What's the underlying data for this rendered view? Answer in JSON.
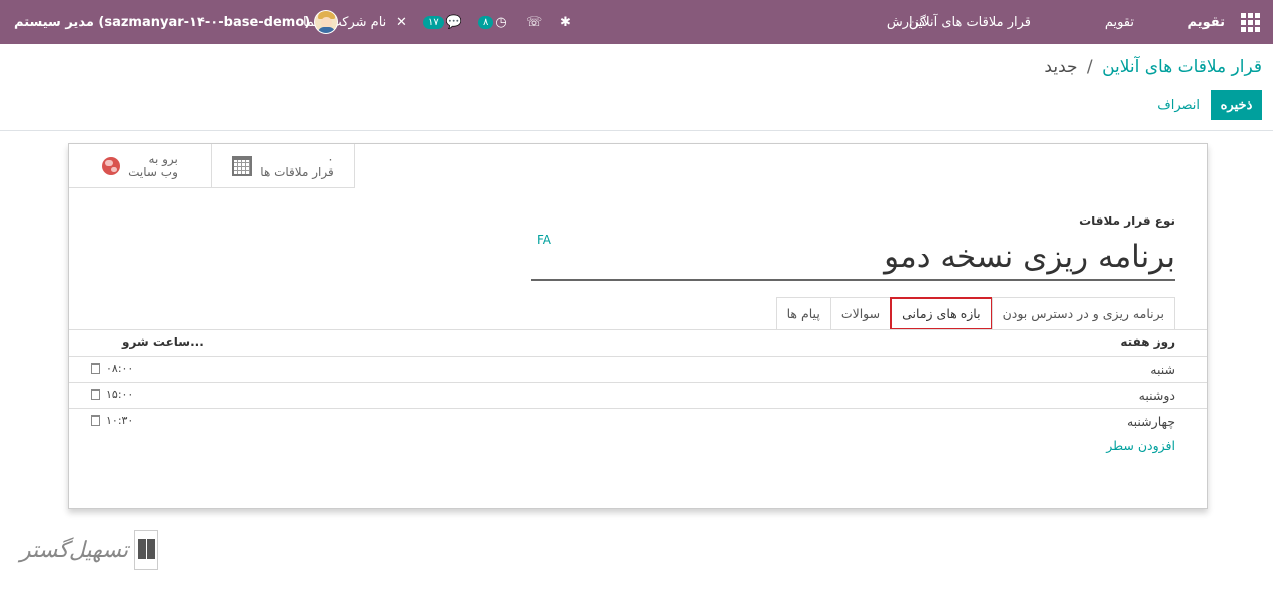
{
  "navbar": {
    "app_name": "تقویم",
    "menus": [
      "تقویم",
      "قرار ملاقات های آنلاین",
      "گزارش"
    ],
    "messages_count": "۱۷",
    "activity_count": "۸",
    "company": "نام شرکت شما",
    "user": "مدیر سیستم (sazmanyar-۱۴-۰-base-demo)",
    "icons": [
      "apps-grid-icon",
      "bug-icon",
      "phone-icon",
      "clock-icon",
      "chat-icon",
      "tools-icon",
      "avatar"
    ],
    "bg_color": "#875a7b"
  },
  "control_panel": {
    "breadcrumb_parent": "قرار ملاقات های آنلاین",
    "breadcrumb_sep": "/",
    "breadcrumb_current": "جدید",
    "save_label": "ذخیره",
    "discard_label": "انصراف",
    "accent_color": "#00a09d"
  },
  "smart_buttons": {
    "website_line1": "برو به",
    "website_line2": "وب سایت",
    "meetings_count": "۰",
    "meetings_label": "قرار ملاقات ها"
  },
  "form": {
    "type_label": "نوع قرار ملاقات",
    "lang": "FA",
    "name": "برنامه ریزی نسخه دمو"
  },
  "tabs": [
    {
      "label": "برنامه ریزی و در دسترس بودن",
      "active": false
    },
    {
      "label": "بازه های زمانی",
      "active": true
    },
    {
      "label": "سوالات",
      "active": false
    },
    {
      "label": "پیام ها",
      "active": false
    }
  ],
  "slots_table": {
    "col_day": "روز هفته",
    "col_time": "ساعت شرو...",
    "rows": [
      {
        "day": "شنبه",
        "time": "۰۸:۰۰"
      },
      {
        "day": "دوشنبه",
        "time": "۱۵:۰۰"
      },
      {
        "day": "چهارشنبه",
        "time": "۱۰:۳۰"
      }
    ],
    "add_line": "افزودن سطر"
  },
  "watermark": {
    "text": "تسهیل‌گستر"
  }
}
